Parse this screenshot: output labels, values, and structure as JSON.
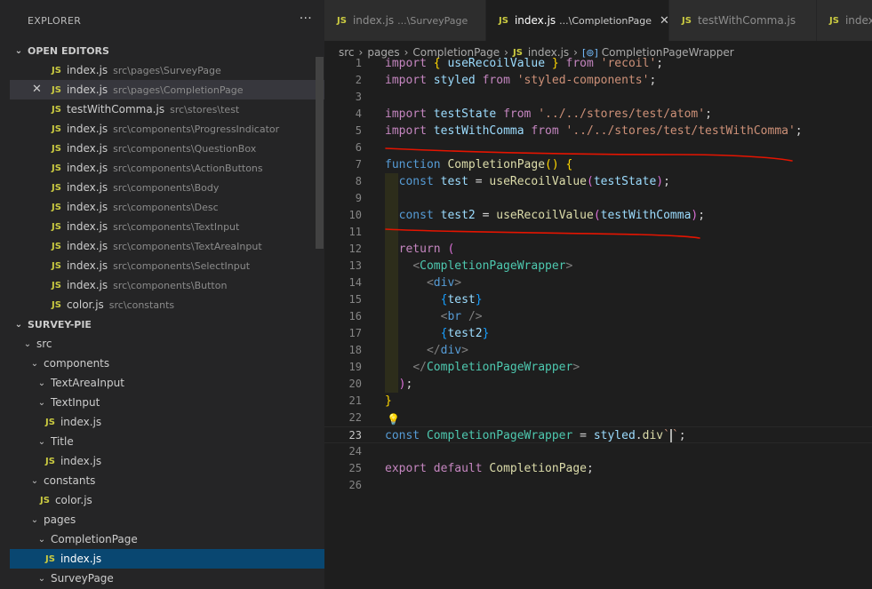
{
  "sidebar": {
    "title": "EXPLORER",
    "more": "···",
    "open_editors": {
      "header": "OPEN EDITORS",
      "items": [
        {
          "name": "index.js",
          "path": "src\\pages\\SurveyPage"
        },
        {
          "name": "index.js",
          "path": "src\\pages\\CompletionPage",
          "close": "✕"
        },
        {
          "name": "testWithComma.js",
          "path": "src\\stores\\test"
        },
        {
          "name": "index.js",
          "path": "src\\components\\ProgressIndicator"
        },
        {
          "name": "index.js",
          "path": "src\\components\\QuestionBox"
        },
        {
          "name": "index.js",
          "path": "src\\components\\ActionButtons"
        },
        {
          "name": "index.js",
          "path": "src\\components\\Body"
        },
        {
          "name": "index.js",
          "path": "src\\components\\Desc"
        },
        {
          "name": "index.js",
          "path": "src\\components\\TextInput"
        },
        {
          "name": "index.js",
          "path": "src\\components\\TextAreaInput"
        },
        {
          "name": "index.js",
          "path": "src\\components\\SelectInput"
        },
        {
          "name": "index.js",
          "path": "src\\components\\Button"
        },
        {
          "name": "color.js",
          "path": "src\\constants"
        }
      ]
    },
    "project": {
      "header": "SURVEY-PIE",
      "tree": [
        {
          "label": "src",
          "type": "folder"
        },
        {
          "label": "components",
          "type": "folder"
        },
        {
          "label": "TextAreaInput",
          "type": "folder-closed"
        },
        {
          "label": "TextInput",
          "type": "folder"
        },
        {
          "label": "index.js",
          "type": "file"
        },
        {
          "label": "Title",
          "type": "folder"
        },
        {
          "label": "index.js",
          "type": "file"
        },
        {
          "label": "constants",
          "type": "folder"
        },
        {
          "label": "color.js",
          "type": "file"
        },
        {
          "label": "pages",
          "type": "folder"
        },
        {
          "label": "CompletionPage",
          "type": "folder"
        },
        {
          "label": "index.js",
          "type": "file"
        },
        {
          "label": "SurveyPage",
          "type": "folder"
        }
      ]
    }
  },
  "icons": {
    "js": "JS",
    "chevron_down": "⌄",
    "chevron_right": "›",
    "symbol": "[⊚]",
    "bulb": "💡"
  },
  "tabs": [
    {
      "name": "index.js",
      "desc": "...\\SurveyPage"
    },
    {
      "name": "index.js",
      "desc": "...\\CompletionPage",
      "close": "✕"
    },
    {
      "name": "testWithComma.js",
      "desc": ""
    },
    {
      "name": "index",
      "desc": ""
    }
  ],
  "breadcrumb": {
    "parts": [
      "src",
      "pages",
      "CompletionPage",
      "index.js",
      "CompletionPageWrapper"
    ],
    "sep": "›"
  },
  "editor": {
    "line_numbers": [
      "1",
      "2",
      "3",
      "4",
      "5",
      "6",
      "7",
      "8",
      "9",
      "10",
      "11",
      "12",
      "13",
      "14",
      "15",
      "16",
      "17",
      "18",
      "19",
      "20",
      "21",
      "22",
      "23",
      "24",
      "25",
      "26"
    ],
    "current_line": "23",
    "annotation_color": "#e51400"
  }
}
